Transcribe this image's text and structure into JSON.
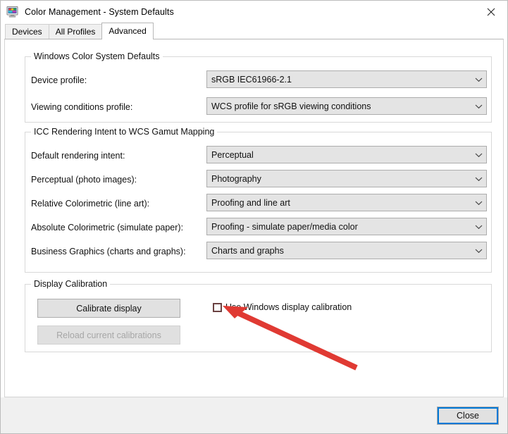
{
  "window": {
    "title": "Color Management - System Defaults",
    "icon": "color-management-monitor-icon",
    "close_label": "✕"
  },
  "tabs": [
    {
      "label": "Devices",
      "selected": false
    },
    {
      "label": "All Profiles",
      "selected": false
    },
    {
      "label": "Advanced",
      "selected": true
    }
  ],
  "groups": {
    "wcs_defaults": {
      "title": "Windows Color System Defaults",
      "rows": [
        {
          "label": "Device profile:",
          "value": "sRGB IEC61966-2.1"
        },
        {
          "label": "Viewing conditions profile:",
          "value": "WCS profile for sRGB viewing conditions"
        }
      ]
    },
    "icc_mapping": {
      "title": "ICC Rendering Intent to WCS Gamut Mapping",
      "rows": [
        {
          "label": "Default rendering intent:",
          "value": "Perceptual"
        },
        {
          "label": "Perceptual (photo images):",
          "value": "Photography"
        },
        {
          "label": "Relative Colorimetric (line art):",
          "value": "Proofing and line art"
        },
        {
          "label": "Absolute Colorimetric (simulate paper):",
          "value": "Proofing - simulate paper/media color"
        },
        {
          "label": "Business Graphics (charts and graphs):",
          "value": "Charts and graphs"
        }
      ]
    },
    "display_calibration": {
      "title": "Display Calibration",
      "calibrate_button": "Calibrate display",
      "reload_button": "Reload current calibrations",
      "checkbox_label": "Use Windows display calibration",
      "checkbox_checked": false
    }
  },
  "footer": {
    "close_label": "Close"
  },
  "colors": {
    "accent_focus": "#0078d7",
    "annotation_red": "#e03a33",
    "checkbox_highlight": "#6b4242",
    "combo_background": "#e4e4e4",
    "button_background": "#e1e1e1"
  }
}
